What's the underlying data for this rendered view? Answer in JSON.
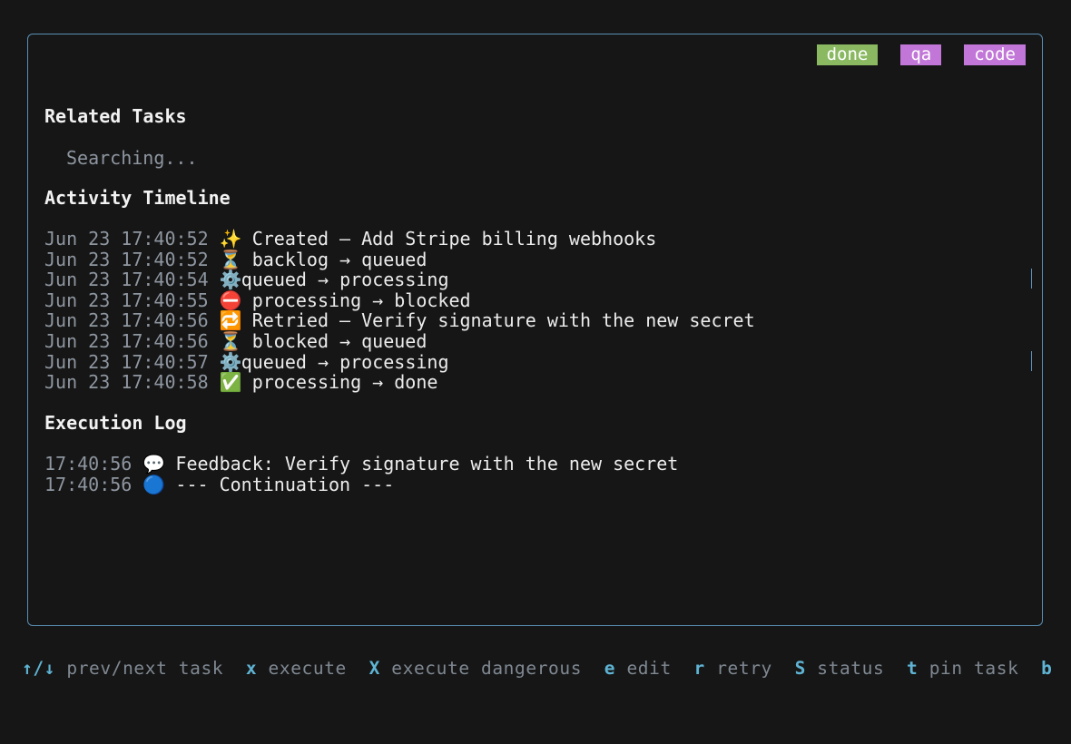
{
  "tags": [
    "done",
    "qa",
    "code"
  ],
  "sections": {
    "related": "Related Tasks",
    "searching": "Searching...",
    "timeline": "Activity Timeline",
    "log": "Execution Log"
  },
  "timeline": [
    {
      "ts": "Jun 23 17:40:52",
      "icon": "✨",
      "icon_name": "sparkles-icon",
      "text": "Created — Add Stripe billing webhooks"
    },
    {
      "ts": "Jun 23 17:40:52",
      "icon": "⏳",
      "icon_name": "hourglass-icon",
      "text": "backlog → queued"
    },
    {
      "ts": "Jun 23 17:40:54",
      "icon": "⚙️",
      "icon_name": "gear-icon",
      "text": "queued → processing"
    },
    {
      "ts": "Jun 23 17:40:55",
      "icon": "⛔",
      "icon_name": "no-entry-icon",
      "text": "processing → blocked"
    },
    {
      "ts": "Jun 23 17:40:56",
      "icon": "🔁",
      "icon_name": "repeat-icon",
      "text": "Retried — Verify signature with the new secret"
    },
    {
      "ts": "Jun 23 17:40:56",
      "icon": "⏳",
      "icon_name": "hourglass-icon",
      "text": "blocked → queued"
    },
    {
      "ts": "Jun 23 17:40:57",
      "icon": "⚙️",
      "icon_name": "gear-icon",
      "text": "queued → processing"
    },
    {
      "ts": "Jun 23 17:40:58",
      "icon": "✅",
      "icon_name": "check-mark-icon",
      "text": "processing → done"
    }
  ],
  "log": [
    {
      "ts": "17:40:56",
      "icon": "💬",
      "icon_name": "speech-bubble-icon",
      "text": "Feedback: Verify signature with the new secret"
    },
    {
      "ts": "17:40:56",
      "icon": "🔵",
      "icon_name": "blue-circle-icon",
      "text": "--- Continuation ---"
    }
  ],
  "shortcuts": [
    {
      "key": "↑/↓",
      "label": "prev/next task"
    },
    {
      "key": "x",
      "label": "execute"
    },
    {
      "key": "X",
      "label": "execute dangerous"
    },
    {
      "key": "e",
      "label": "edit"
    },
    {
      "key": "r",
      "label": "retry"
    },
    {
      "key": "S",
      "label": "status"
    },
    {
      "key": "t",
      "label": "pin task"
    },
    {
      "key": "b",
      "label": ""
    }
  ]
}
